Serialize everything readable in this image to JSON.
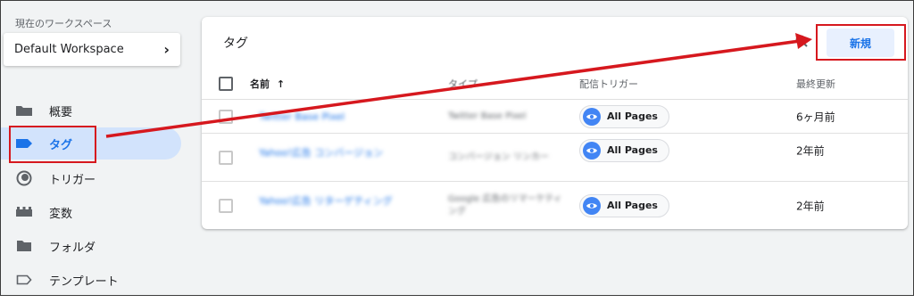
{
  "workspace": {
    "caption": "現在のワークスペース",
    "name": "Default Workspace",
    "chevron": "›"
  },
  "nav": [
    {
      "label": "概要",
      "icon": "folder-filled-icon"
    },
    {
      "label": "タグ",
      "icon": "tag-icon"
    },
    {
      "label": "トリガー",
      "icon": "trigger-icon"
    },
    {
      "label": "変数",
      "icon": "variables-icon"
    },
    {
      "label": "フォルダ",
      "icon": "folder-icon"
    },
    {
      "label": "テンプレート",
      "icon": "template-icon"
    }
  ],
  "panel": {
    "title": "タグ",
    "new_button": "新規"
  },
  "table": {
    "headers": {
      "name": "名前",
      "sort": "↑",
      "type": "タイプ",
      "trigger": "配信トリガー",
      "updated": "最終更新"
    },
    "rows": [
      {
        "name": "Twitter Base Pixel",
        "type": "Twitter Base Pixel",
        "trigger": "All Pages",
        "updated": "6ヶ月前"
      },
      {
        "name": "Yahoo!広告 コンバージョン",
        "type": "コンバージョン リンカー",
        "trigger": "All Pages",
        "updated": "2年前"
      },
      {
        "name": "Yahoo!広告 リターゲティング",
        "type": "Google 広告のリマーケティング",
        "trigger": "All Pages",
        "updated": "2年前"
      }
    ]
  },
  "colors": {
    "accent": "#1a73e8",
    "annotation": "#d6181e",
    "active_nav_bg": "#d2e3fc"
  }
}
